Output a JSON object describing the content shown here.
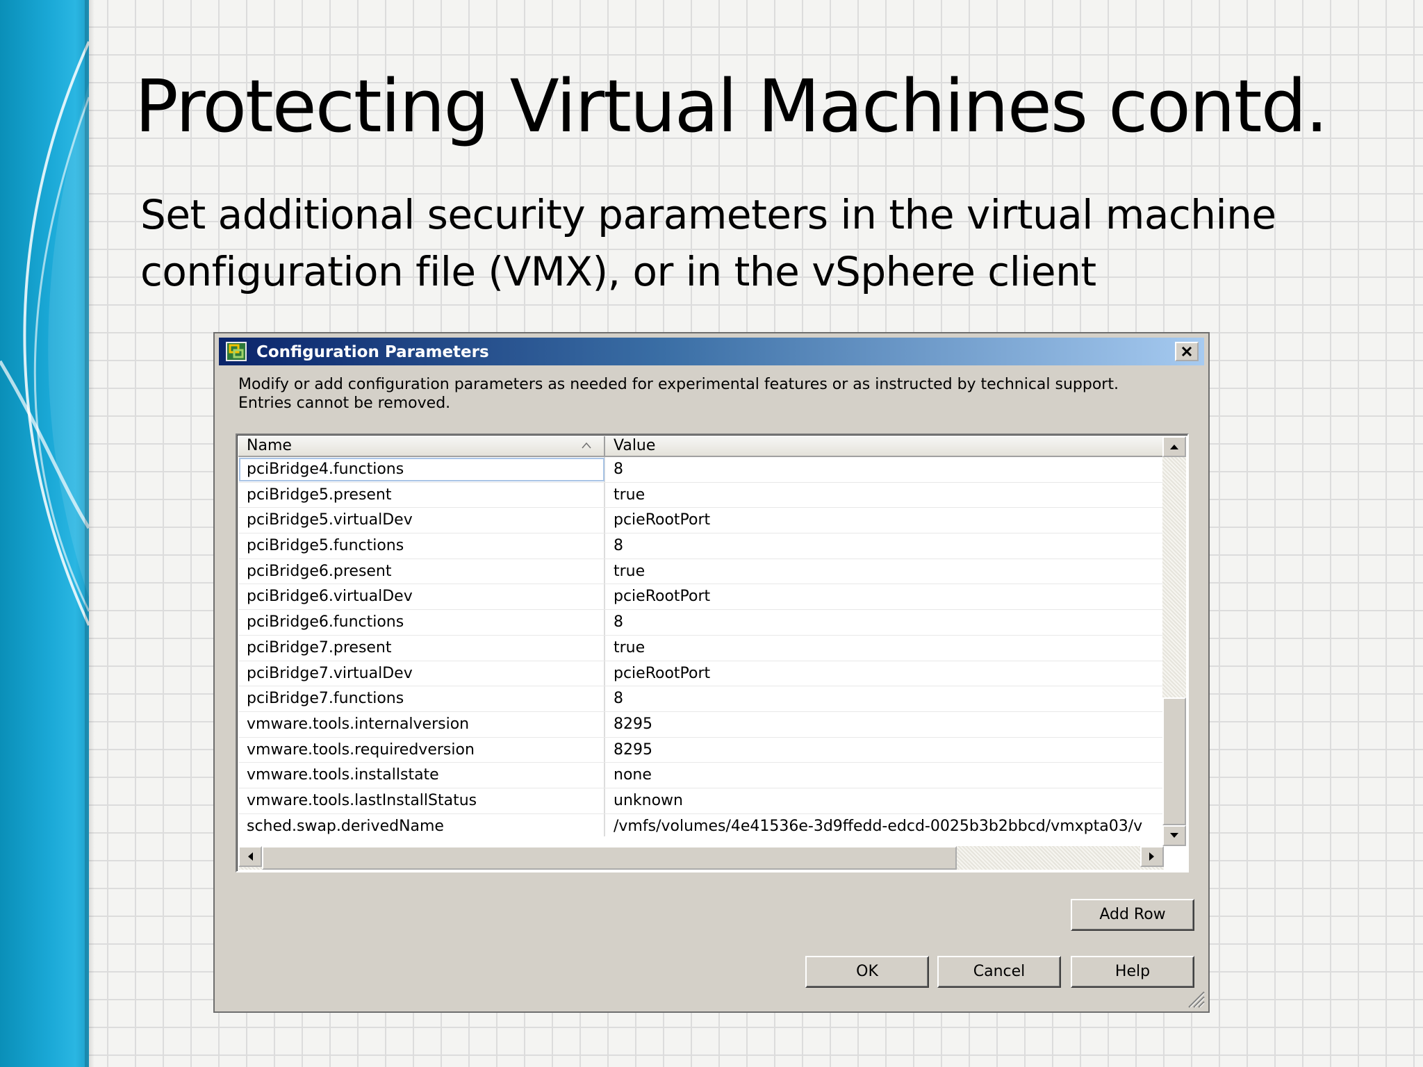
{
  "slide": {
    "title": "Protecting Virtual Machines contd.",
    "subtitle": "Set additional security parameters in the virtual machine configuration  file (VMX), or in the vSphere client",
    "accent_color": "#1aa8d6"
  },
  "dialog": {
    "title": "Configuration Parameters",
    "icon": "vmware-app-icon",
    "instructions_line1": "Modify or add configuration parameters as needed for experimental features or as instructed by technical support.",
    "instructions_line2": "Entries cannot be removed.",
    "titlebar_color": "#0a246a",
    "table": {
      "columns": [
        "Name",
        "Value"
      ],
      "rows": [
        {
          "name": "pciBridge4.functions",
          "value": "8"
        },
        {
          "name": "pciBridge5.present",
          "value": "true"
        },
        {
          "name": "pciBridge5.virtualDev",
          "value": "pcieRootPort"
        },
        {
          "name": "pciBridge5.functions",
          "value": "8"
        },
        {
          "name": "pciBridge6.present",
          "value": "true"
        },
        {
          "name": "pciBridge6.virtualDev",
          "value": "pcieRootPort"
        },
        {
          "name": "pciBridge6.functions",
          "value": "8"
        },
        {
          "name": "pciBridge7.present",
          "value": "true"
        },
        {
          "name": "pciBridge7.virtualDev",
          "value": "pcieRootPort"
        },
        {
          "name": "pciBridge7.functions",
          "value": "8"
        },
        {
          "name": "vmware.tools.internalversion",
          "value": "8295"
        },
        {
          "name": "vmware.tools.requiredversion",
          "value": "8295"
        },
        {
          "name": "vmware.tools.installstate",
          "value": "none"
        },
        {
          "name": "vmware.tools.lastInstallStatus",
          "value": "unknown"
        },
        {
          "name": "sched.swap.derivedName",
          "value": "/vmfs/volumes/4e41536e-3d9ffedd-edcd-0025b3b2bbcd/vmxpta03/v"
        }
      ]
    },
    "buttons": {
      "add_row": "Add Row",
      "ok": "OK",
      "cancel": "Cancel",
      "help": "Help"
    }
  }
}
